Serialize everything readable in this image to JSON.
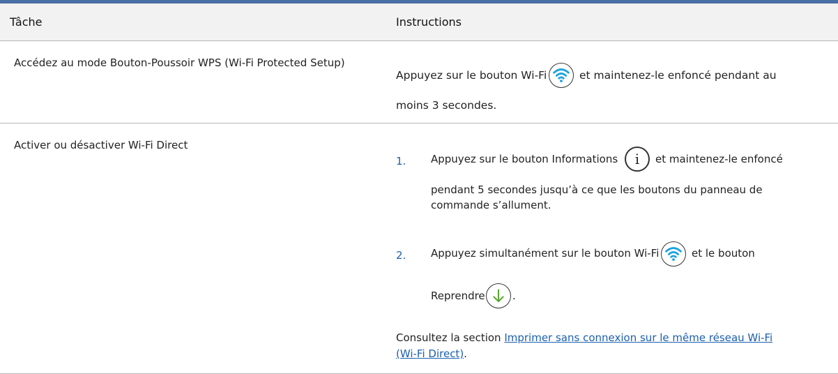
{
  "header": {
    "col_task": "Tâche",
    "col_instructions": "Instructions"
  },
  "rows": [
    {
      "task": "Accédez au mode Bouton-Poussoir WPS (Wi-Fi Protected Setup)",
      "instr_before": "Appuyez sur le bouton Wi-Fi",
      "instr_after": "et maintenez-le enfoncé pendant au",
      "instr_line2": "moins 3 secondes.",
      "icon": "wifi-icon"
    },
    {
      "task": "Activer ou désactiver Wi-Fi Direct",
      "steps": [
        {
          "number": "1.",
          "before": "Appuyez sur le bouton Informations",
          "after": "et maintenez-le enfoncé",
          "line2": "pendant 5 secondes jusqu’à ce que les boutons du panneau de",
          "line3": "commande s’allument.",
          "icon": "info-icon"
        },
        {
          "number": "2.",
          "before": "Appuyez simultanément sur le bouton Wi-Fi",
          "after": "et le bouton",
          "line2": "Reprendre",
          "line2_end": ".",
          "icon": "wifi-icon",
          "icon2": "resume-arrow-icon"
        }
      ],
      "note_prefix": "Consultez la section ",
      "note_link_line1": "Imprimer sans connexion sur le même réseau Wi-Fi",
      "note_link_line2": "(Wi-Fi Direct)",
      "note_suffix": "."
    }
  ],
  "colors": {
    "wifi_blue": "#1fa3e0",
    "resume_green": "#5aa832",
    "link_blue": "#1b5fae",
    "top_bar": "#4a6fa5"
  }
}
